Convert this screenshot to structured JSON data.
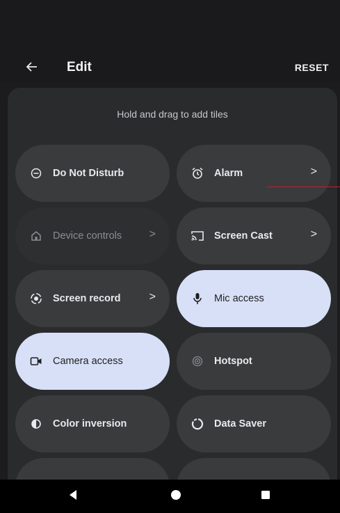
{
  "header": {
    "title": "Edit",
    "reset_label": "RESET"
  },
  "panel": {
    "hint": "Hold and drag to add tiles"
  },
  "tiles": [
    {
      "label": "Do Not Disturb",
      "icon": "do-not-disturb-icon",
      "has_chevron": false,
      "state": "inactive"
    },
    {
      "label": "Alarm",
      "icon": "alarm-icon",
      "has_chevron": true,
      "chevron": ">",
      "state": "inactive"
    },
    {
      "label": "Device controls",
      "icon": "home-icon",
      "has_chevron": true,
      "chevron": ">",
      "state": "disabled"
    },
    {
      "label": "Screen Cast",
      "icon": "cast-icon",
      "has_chevron": true,
      "chevron": ">",
      "state": "inactive"
    },
    {
      "label": "Screen record",
      "icon": "screen-record-icon",
      "has_chevron": true,
      "chevron": ">",
      "state": "inactive"
    },
    {
      "label": "Mic access",
      "icon": "mic-icon",
      "has_chevron": false,
      "state": "active"
    },
    {
      "label": "Camera access",
      "icon": "camera-icon",
      "has_chevron": false,
      "state": "active"
    },
    {
      "label": "Hotspot",
      "icon": "hotspot-icon",
      "has_chevron": false,
      "state": "inactive"
    },
    {
      "label": "Color inversion",
      "icon": "color-inversion-icon",
      "has_chevron": false,
      "state": "inactive"
    },
    {
      "label": "Data Saver",
      "icon": "data-saver-icon",
      "has_chevron": false,
      "state": "inactive"
    }
  ],
  "navbar": {
    "back": "back-triangle-icon",
    "home": "home-circle-icon",
    "recents": "recents-square-icon"
  },
  "colors": {
    "background": "#1a1a1c",
    "panel": "#2a2b2d",
    "tile": "#3a3b3d",
    "tile_active": "#d8e0f8",
    "text": "#e8eaed"
  }
}
